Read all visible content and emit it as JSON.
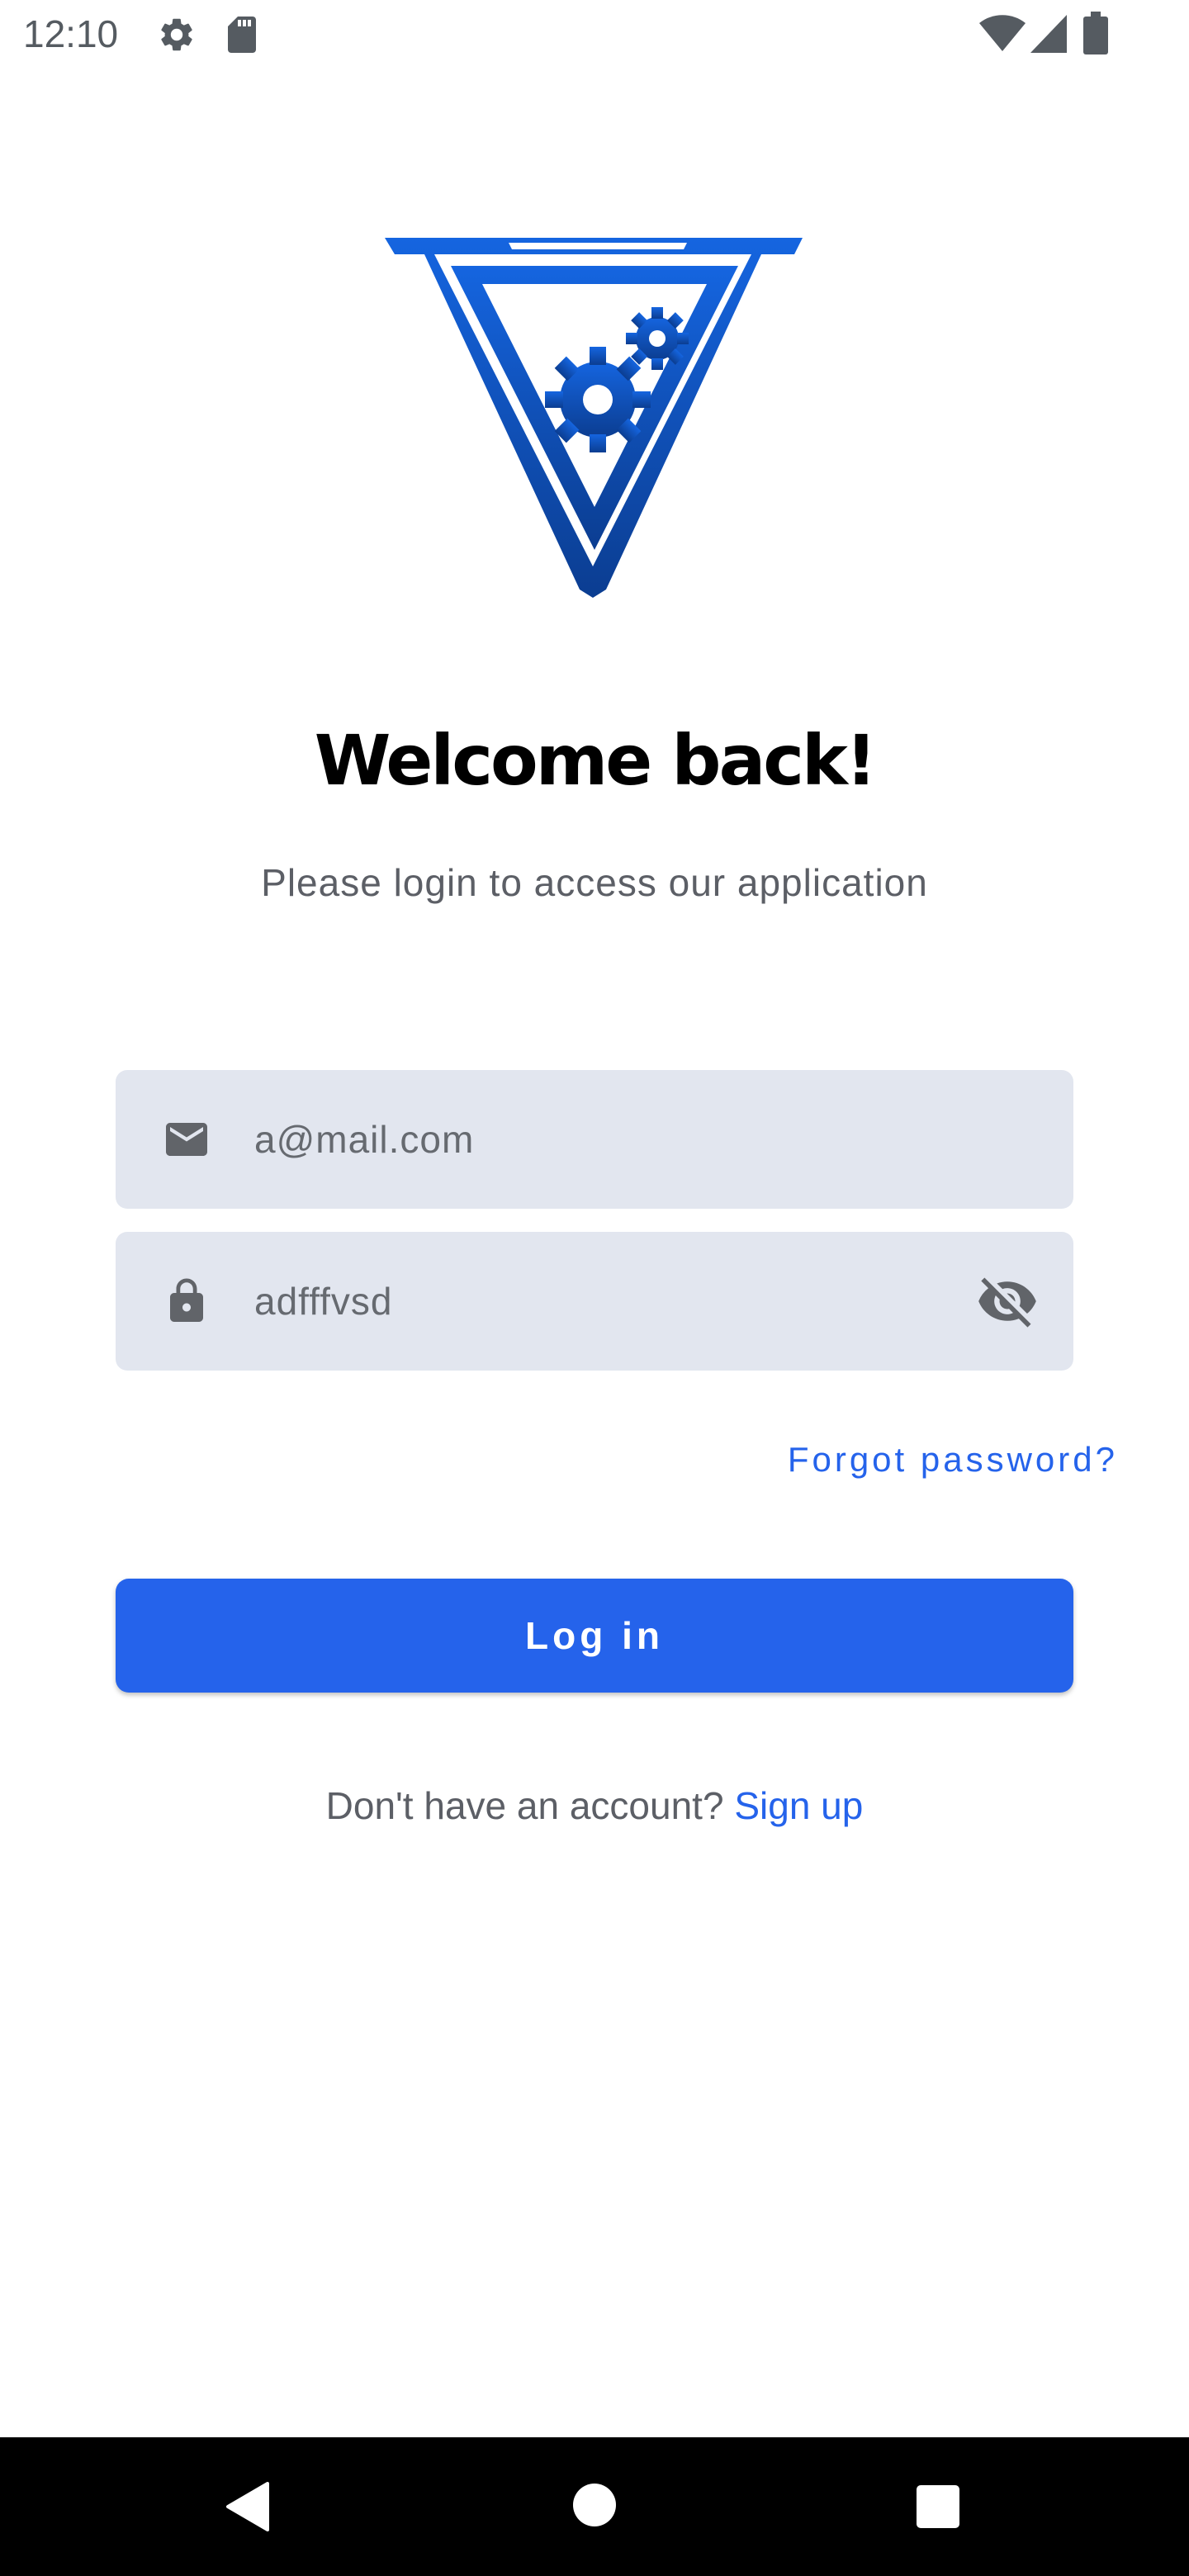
{
  "status_bar": {
    "time": "12:10",
    "left_icons": [
      "gear-icon",
      "sd-card-icon"
    ],
    "right_icons": [
      "wifi-icon",
      "signal-icon",
      "battery-icon"
    ]
  },
  "logo": {
    "icon": "gears-triangle-logo",
    "colors": [
      "#1565e0",
      "#0b3d91"
    ]
  },
  "header": {
    "title": "Welcome back!",
    "subtitle": "Please login to access our application"
  },
  "form": {
    "email": {
      "icon": "mail-icon",
      "value": "a@mail.com"
    },
    "password": {
      "icon": "lock-icon",
      "value": "adfffvsd",
      "toggle_icon": "eye-off-icon"
    },
    "forgot_password": "Forgot password?",
    "login_label": "Log in",
    "signup_prompt": "Don't have an account?",
    "signup_link": "Sign up"
  },
  "colors": {
    "accent": "#2563eb",
    "field_background": "#e2e6ef",
    "text_muted": "#5c5f66"
  },
  "nav_bar": {
    "buttons": [
      "back-icon",
      "home-icon",
      "recents-icon"
    ]
  }
}
